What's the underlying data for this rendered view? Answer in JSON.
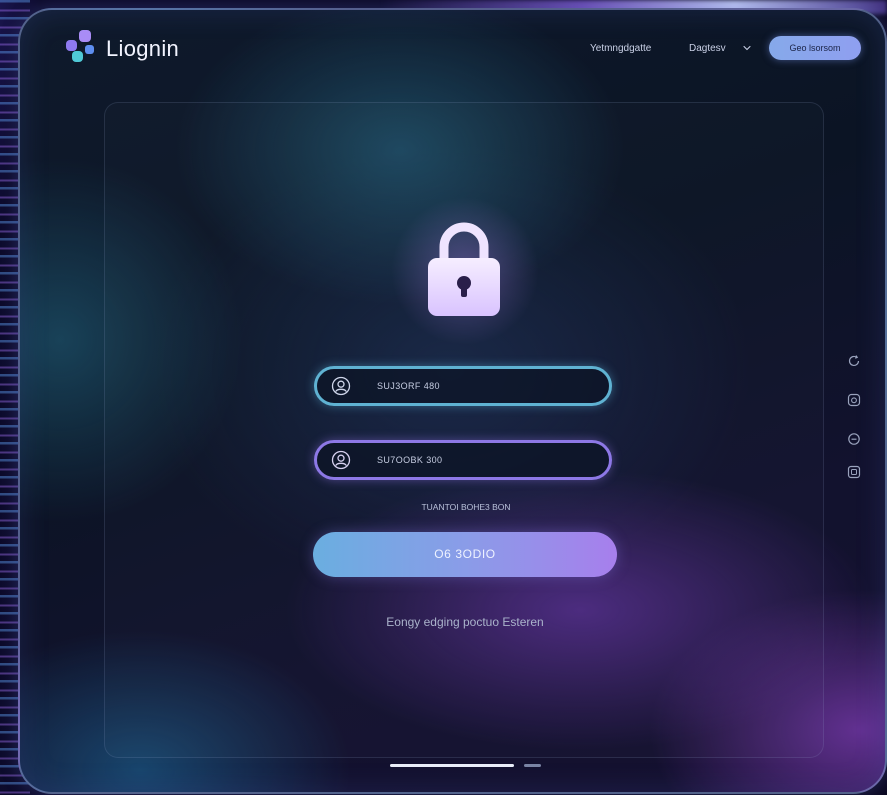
{
  "app": {
    "brand": "Liognin"
  },
  "header": {
    "nav": [
      {
        "label": "Yetmngdgatte"
      },
      {
        "label": "Dagtesv"
      }
    ],
    "cta_label": "Geo lsorsom"
  },
  "login": {
    "username": {
      "value": "SUJ3ORF 480",
      "icon": "user-icon"
    },
    "password": {
      "value": "SU7OOBK 300",
      "icon": "user-icon"
    },
    "forgot_label": "TUANTOI BOHE3 BON",
    "submit_label": "O6 3ODIO",
    "footer_text": "Eongy edging poctuo Esteren"
  },
  "side_icons": [
    "refresh-icon",
    "instagram-icon",
    "minus-circle-icon",
    "square-icon"
  ],
  "pagination": {
    "pages": 2,
    "active": 1
  },
  "colors": {
    "accent_teal": "#5fb2d2",
    "accent_violet": "#8d78e6",
    "button_gradient_start": "#6aaee0",
    "button_gradient_end": "#a77fec"
  }
}
